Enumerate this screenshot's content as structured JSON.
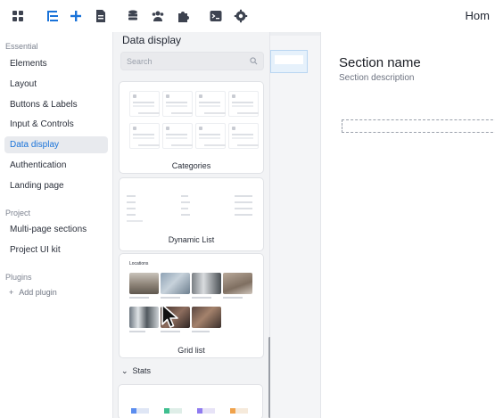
{
  "toolbar": {
    "icons": [
      "grid-icon",
      "layers-icon",
      "plus-icon",
      "page-icon",
      "database-icon",
      "users-icon",
      "puzzle-icon",
      "terminal-icon",
      "gear-icon"
    ],
    "right_label": "Hom"
  },
  "sidebar": {
    "essential_label": "Essential",
    "items": [
      {
        "label": "Elements"
      },
      {
        "label": "Layout"
      },
      {
        "label": "Buttons & Labels"
      },
      {
        "label": "Input & Controls"
      },
      {
        "label": "Data display",
        "active": true
      },
      {
        "label": "Authentication"
      },
      {
        "label": "Landing page"
      }
    ],
    "project_label": "Project",
    "project_items": [
      {
        "label": "Multi-page sections"
      },
      {
        "label": "Project UI kit"
      }
    ],
    "plugins_label": "Plugins",
    "add_plugin_label": "Add plugin"
  },
  "panel": {
    "title": "Data display",
    "search_placeholder": "Search",
    "cards": [
      {
        "label": "Categories"
      },
      {
        "label": "Dynamic List"
      },
      {
        "label": "Grid list"
      }
    ],
    "grid_list_heading": "Locations",
    "stats_label": "Stats"
  },
  "canvas": {
    "section_title": "Section name",
    "section_description": "Section description"
  },
  "colors": {
    "accent": "#1a73d9",
    "active_bg": "#e8eaee"
  }
}
